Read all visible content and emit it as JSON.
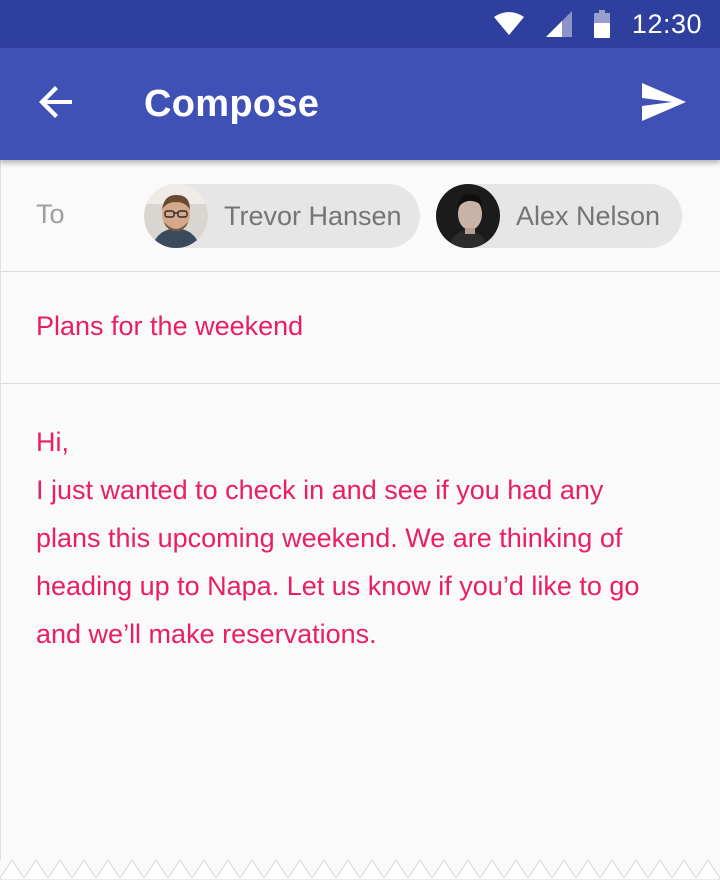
{
  "status_bar": {
    "time": "12:30",
    "icons": [
      "wifi-icon",
      "cell-signal-icon",
      "battery-icon"
    ]
  },
  "app_bar": {
    "title": "Compose",
    "back_icon": "arrow-back-icon",
    "send_icon": "send-icon"
  },
  "recipients": {
    "label": "To",
    "chips": [
      {
        "name": "Trevor Hansen"
      },
      {
        "name": "Alex Nelson"
      }
    ]
  },
  "subject": {
    "value": "Plans for the weekend"
  },
  "body": {
    "lines": [
      "Hi,",
      "I just wanted to check in and see if you had any",
      "plans this upcoming weekend. We are thinking of",
      "heading up to Napa. Let us know if you’d like to go",
      "and we’ll make reservations."
    ]
  },
  "colors": {
    "status_bar": "#2f3f9e",
    "app_bar": "#3f51b5",
    "accent_text": "#e91e63",
    "chip_bg": "#e6e6e6",
    "background": "#fafafa"
  }
}
